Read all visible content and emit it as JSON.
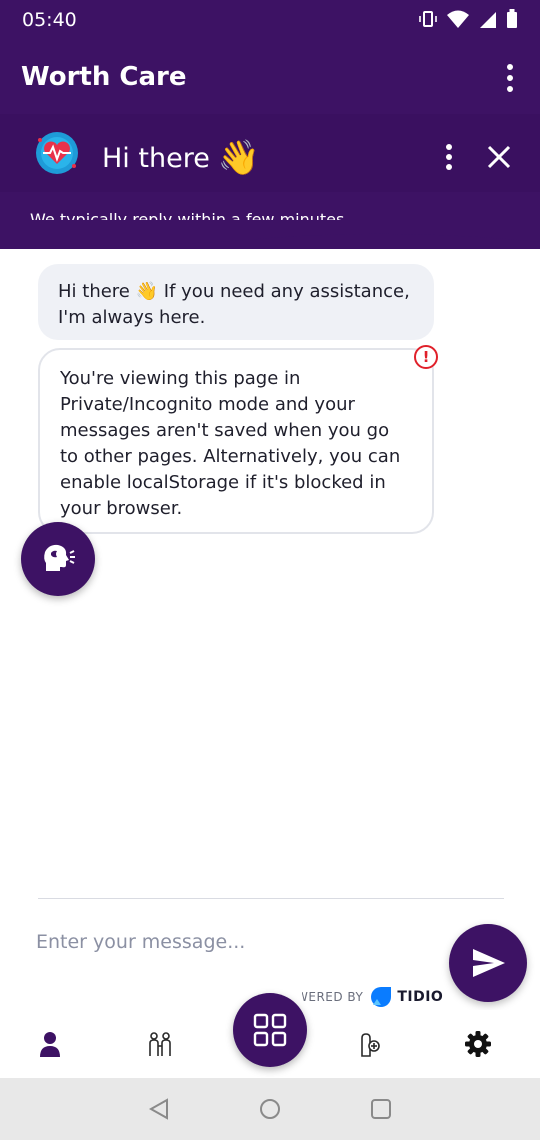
{
  "status_bar": {
    "time": "05:40",
    "icons": [
      "vibrate-icon",
      "wifi-icon",
      "signal-icon",
      "battery-icon"
    ]
  },
  "app_bar": {
    "title": "Worth Care",
    "menu_icon": "more-vert-icon"
  },
  "chat_header": {
    "greeting": "Hi there",
    "greeting_emoji": "👋",
    "reply_info": "We typically reply within a few minutes.",
    "menu_icon": "more-vert-icon",
    "close_icon": "close-icon"
  },
  "messages": [
    {
      "text_before_emoji": "Hi there",
      "emoji": "👋",
      "text_after_emoji": "If you need any assistance, I'm always here."
    }
  ],
  "warning": {
    "text": "You're viewing this page in Private/Incognito mode and your messages aren't saved when you go to other pages. Alternatively, you can enable localStorage if it's blocked in your browser.",
    "icon_glyph": "!"
  },
  "composer": {
    "placeholder": "Enter your message...",
    "send_icon": "send-icon"
  },
  "branding": {
    "powered_by": "WERED BY",
    "brand": "TIDIO"
  },
  "bottom_nav": {
    "items": [
      "person-icon",
      "people-icon",
      "grid-icon",
      "hand-add-icon",
      "gear-icon"
    ]
  },
  "colors": {
    "primary": "#3d1264",
    "bubble_bg": "#eff1f6",
    "error": "#e0202a",
    "system_nav_bg": "#e8e8e8"
  }
}
